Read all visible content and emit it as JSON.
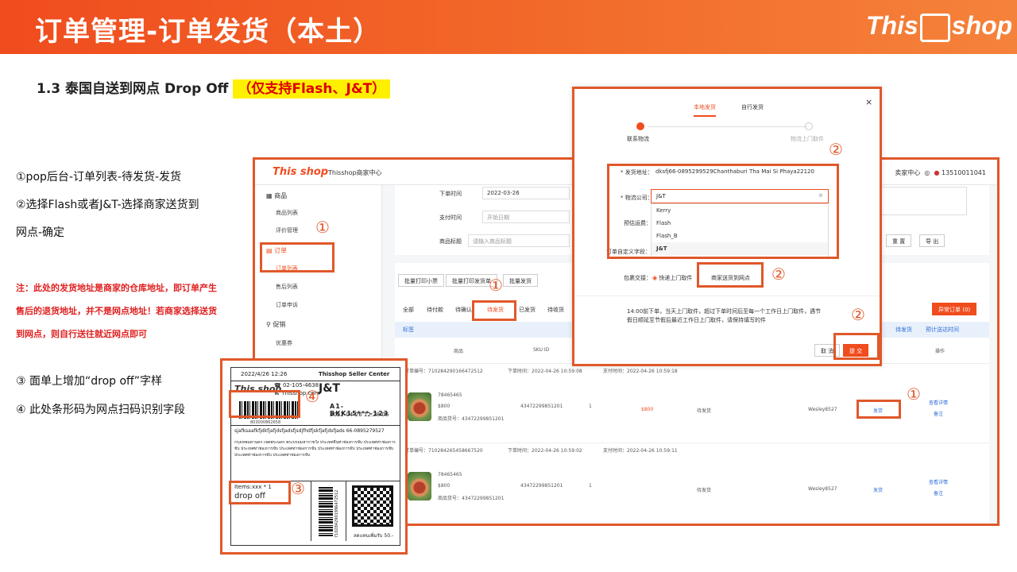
{
  "header": {
    "title": "订单管理-订单发货（本土）",
    "logo_text": "This",
    "logo_text2": "shop"
  },
  "section": {
    "title": "1.3 泰国自送到网点 Drop Off ",
    "highlight": "（仅支持Flash、J&T）"
  },
  "steps": {
    "s1": "①pop后台-订单列表-待发货-发货",
    "s2": "②选择Flash或者J&T-选择商家送货到",
    "s2b": "网点-确定",
    "s3": "③ 面单上增加“drop off”字样",
    "s4": "④ 此处条形码为网点扫码识别字段"
  },
  "note": "注：此处的发货地址是商家的仓库地址，即订单产生售后的退货地址，并不是网点地址！若商家选择送货到网点，则自行送往就近网点即可",
  "shot": {
    "logo": "This shop",
    "center_name": "Thisshop商家中心",
    "right_user": "13510011041",
    "right_center": "卖家中心",
    "sidebar": {
      "goods": "商品",
      "goods_list": "商品列表",
      "reviews": "评价管理",
      "orders": "订单",
      "order_list": "订单列表",
      "after_sale": "售后列表",
      "order_complaint": "订单申诉",
      "promo": "促销",
      "coupon": "优惠券"
    },
    "filters": {
      "order_time": "下单时间",
      "order_time_val": "2022-03-26",
      "pay_time": "支付时间",
      "pay_time_val": "开始日期",
      "title": "商品标题",
      "title_ph": "请输入商品标题",
      "reset": "重 置",
      "export": "导 出"
    },
    "actions": {
      "print_ticket": "批量打印小票",
      "print_label": "批量打印发货单",
      "batch_ship": "批量发货"
    },
    "tabs": {
      "all": "全部",
      "unpaid": "待付款",
      "to_confirm": "待确认",
      "to_ship": "待发货",
      "shipped": "已发货",
      "done": "待收货"
    },
    "banner": "标签",
    "pending_btn": "异常订单 (0)",
    "shipped_sort": "待发货",
    "est_sort": "预计送达时间",
    "cols": {
      "product": "商品",
      "sku": "SKU ID",
      "op": "操作",
      "status": "状态"
    },
    "orders": [
      {
        "no": "订单编号：7102842901664725​12",
        "order_time": "下单时间：2022-04-26 10:59:08",
        "pay_time": "支付时间：2022-04-26 10:59:18",
        "sku_a": "78465465",
        "sku_b": "$800",
        "goods_no": "商品货号：43472299851201",
        "sku_id": "43472299851201",
        "qty": "1",
        "price": "$800",
        "status": "待发货",
        "buyer": "Wesley8527",
        "ship": "发货",
        "detail": "查看详情",
        "remark": "备注"
      },
      {
        "no": "订单编号：7102842654586675​20",
        "order_time": "下单时间：2022-04-26 10:59:02",
        "pay_time": "支付时间：2022-04-26 10:59:11",
        "sku_a": "78465465",
        "sku_b": "$800",
        "goods_no": "商品货号：43472299851201",
        "sku_id": "43472299851201",
        "qty": "1",
        "price": "$800",
        "status": "待发货",
        "buyer": "Wesley8527",
        "ship": "发货",
        "detail": "查看详情",
        "remark": "备注"
      }
    ]
  },
  "modal": {
    "tab1": "本地发货",
    "tab2": "自行发货",
    "step1": "联系物流",
    "step2": "物流上门取件",
    "ship_addr_label": "* 发货地址：",
    "ship_addr_val": "dksfj66-0895299529Chanthaburi Tha Mai Si Phaya22120",
    "carrier_label": "* 物流公司：",
    "carrier_val": "J&T",
    "est_label": "预估运费：",
    "remark_label": "订单自定义字段：",
    "options": [
      "Kerry",
      "Flash",
      "Flash_B",
      "J&T"
    ],
    "pickup_label": "包裹交接：",
    "pickup_opt1": "快递上门取件",
    "pickup_opt2": "商家送货到网点",
    "notice": "14:00前下单，当天上门取件，超过下单时间后至每一个工作日上门取件，遇节假日顺延至节假后最近工作日上门取件，请保持填写的件",
    "cancel": "取 消",
    "submit": "提 交"
  },
  "label": {
    "date": "2022/4/26 12:26",
    "seller": "Thisshop Seller Center",
    "phone": "02-105-4638",
    "site": "Thisshop.com",
    "carrier": "J&T",
    "route": "A1-BKK15***-123",
    "time": "2022-04-26 12:28:06",
    "barcode_no": "803000862658",
    "recipient": "sjafksaafkfjdkfjafjdsfjadsfjsdjfhdfjskfjafjdsfjads 66-0895279527",
    "address": "กรุงเทพมหานคร เขตพระนคร พระบรมมหาราชวัง ประเทศจีนท่าช่องการขับ ประเทศท่าช่องการขับ ประเทศท่าช่องการขับ ประเทศท่าช่องการขับ ประเทศท่าช่องการขับ ประเทศท่าช่องการขับ ประเทศท่าช่องการขับ ประเทศท่าช่องการขับ",
    "items": "Items:xxx * 1",
    "drop_off": "drop off",
    "side_code": "71028429019964725​12",
    "price_text": "ลดแทนเพิ่มรับ 50.-"
  },
  "markers": {
    "c1": "①",
    "c2": "②",
    "c3": "③",
    "c4": "④"
  }
}
